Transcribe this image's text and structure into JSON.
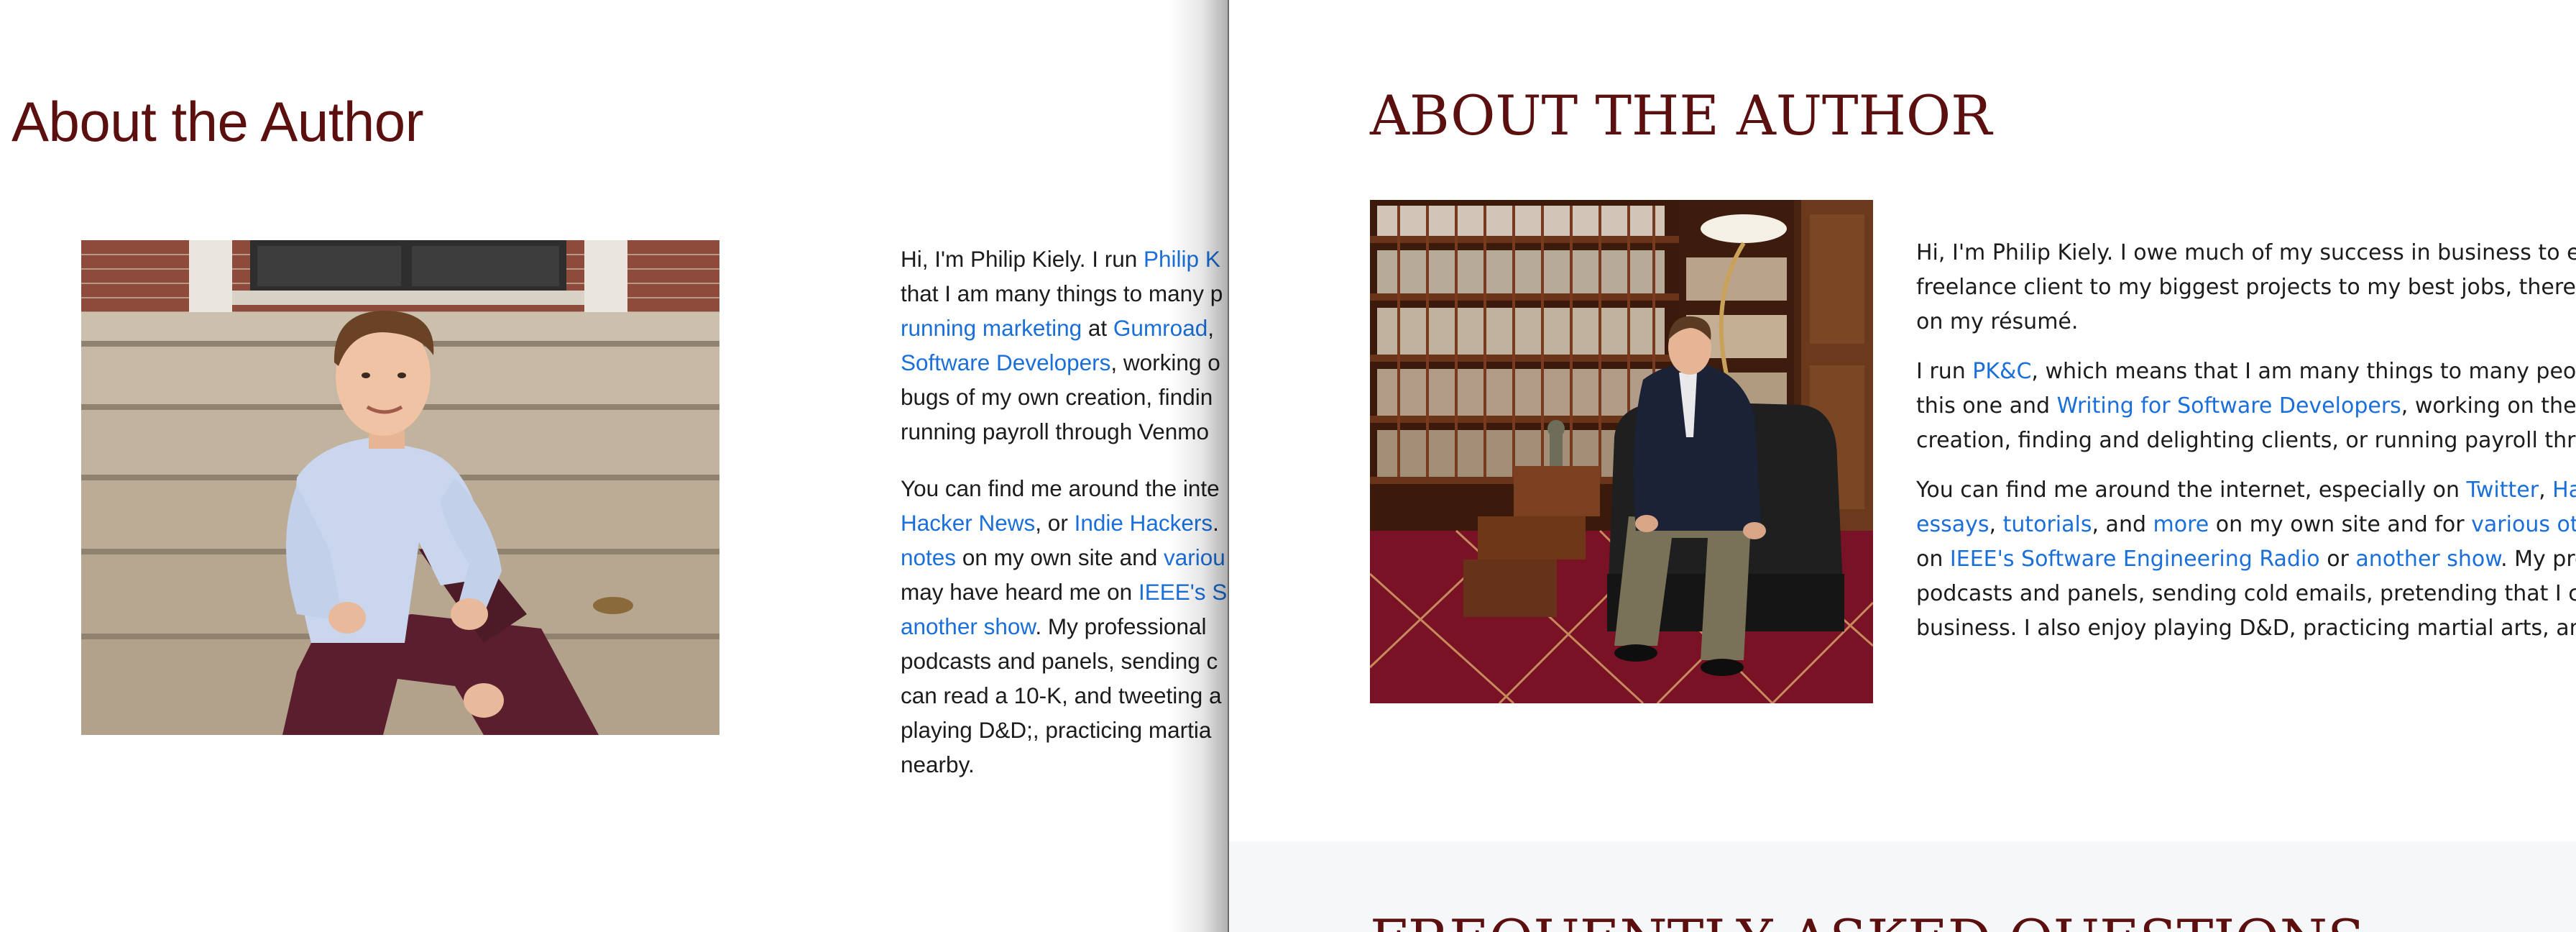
{
  "left_page": {
    "title": "About the Author",
    "paragraphs": [
      [
        [
          {
            "t": "Hi, I'm Philip Kiely. I run "
          },
          {
            "t": "Philip K",
            "link": true
          }
        ],
        [
          {
            "t": "that I am many things to many p"
          }
        ],
        [
          {
            "t": "running marketing",
            "link": true
          },
          {
            "t": " at "
          },
          {
            "t": "Gumroad",
            "link": true
          },
          {
            "t": ","
          }
        ],
        [
          {
            "t": "Software Developers",
            "link": true
          },
          {
            "t": ", working o"
          }
        ],
        [
          {
            "t": "bugs of my own creation, findin"
          }
        ],
        [
          {
            "t": "running payroll through Venmo"
          }
        ]
      ],
      [
        [
          {
            "t": "You can find me around the inte"
          }
        ],
        [
          {
            "t": "Hacker News",
            "link": true
          },
          {
            "t": ", or "
          },
          {
            "t": "Indie Hackers",
            "link": true
          },
          {
            "t": "."
          }
        ],
        [
          {
            "t": "notes",
            "link": true
          },
          {
            "t": " on my own site and "
          },
          {
            "t": "variou",
            "link": true
          }
        ],
        [
          {
            "t": "may have heard me on "
          },
          {
            "t": "IEEE's S",
            "link": true
          }
        ],
        [
          {
            "t": "another show",
            "link": true
          },
          {
            "t": ". My professional"
          }
        ],
        [
          {
            "t": "podcasts and panels, sending c"
          }
        ],
        [
          {
            "t": "can read a 10-K, and tweeting a"
          }
        ],
        [
          {
            "t": "playing D&D;, practicing martia"
          }
        ],
        [
          {
            "t": "nearby."
          }
        ]
      ]
    ]
  },
  "right_page": {
    "title": "ABOUT THE AUTHOR",
    "paragraphs": [
      [
        [
          {
            "t": "Hi, I'm Philip Kiely. I owe much of my success in business to effe"
          }
        ],
        [
          {
            "t": "freelance client to my biggest projects to my best jobs, there is a"
          }
        ],
        [
          {
            "t": "on my résumé."
          }
        ]
      ],
      [
        [
          {
            "t": "I run "
          },
          {
            "t": "PK&C",
            "link": true
          },
          {
            "t": ", which means that I am many things to many people."
          }
        ],
        [
          {
            "t": "this one and "
          },
          {
            "t": "Writing for Software Developers",
            "link": true
          },
          {
            "t": ", working on the nex"
          }
        ],
        [
          {
            "t": "creation, finding and delighting clients, or running payroll throug"
          }
        ]
      ],
      [
        [
          {
            "t": "You can find me around the internet, especially on "
          },
          {
            "t": "Twitter",
            "link": true
          },
          {
            "t": ", "
          },
          {
            "t": "Hacke",
            "link": true
          }
        ],
        [
          {
            "t": "essays",
            "link": true
          },
          {
            "t": ", "
          },
          {
            "t": "tutorials",
            "link": true
          },
          {
            "t": ", and "
          },
          {
            "t": "more",
            "link": true
          },
          {
            "t": " on my own site and for "
          },
          {
            "t": "various other",
            "link": true
          }
        ],
        [
          {
            "t": "on "
          },
          {
            "t": "IEEE's Software Engineering Radio",
            "link": true
          },
          {
            "t": " or "
          },
          {
            "t": "another show",
            "link": true
          },
          {
            "t": ". My profe"
          }
        ],
        [
          {
            "t": "podcasts and panels, sending cold emails, pretending that I can"
          }
        ],
        [
          {
            "t": "business. I also enjoy playing D&D, practicing martial arts, and re"
          }
        ]
      ]
    ],
    "faq_title": "FREQUENTLY ASKED QUESTIONS"
  }
}
